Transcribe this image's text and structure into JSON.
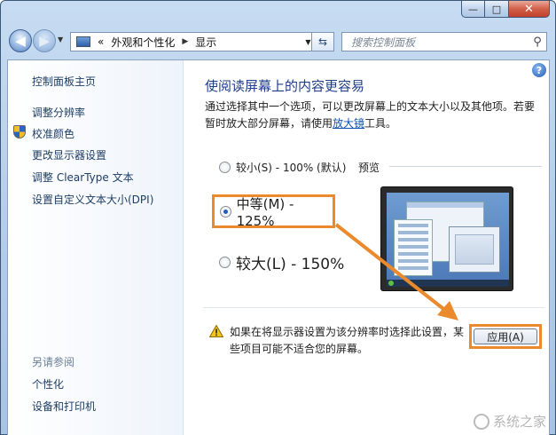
{
  "window": {
    "caption_buttons": {
      "minimize": "—",
      "maximize": "□",
      "close": "✕"
    }
  },
  "navbar": {
    "back_icon": "back-arrow-icon",
    "forward_icon": "forward-arrow-icon",
    "breadcrumb": {
      "prefix": "«",
      "segments": [
        "外观和个性化",
        "显示"
      ]
    },
    "search_placeholder": "搜索控制面板"
  },
  "sidebar": {
    "links": [
      "控制面板主页",
      "调整分辨率",
      "校准颜色",
      "更改显示器设置",
      "调整 ClearType 文本",
      "设置自定义文本大小(DPI)"
    ],
    "see_also_title": "另请参阅",
    "see_also_links": [
      "个性化",
      "设备和打印机"
    ]
  },
  "main": {
    "help": "?",
    "heading": "使阅读屏幕上的内容更容易",
    "desc_part1": "通过选择其中一个选项，可以更改屏幕上的文本大小以及其他项。若要暂时放大部分屏幕，请使用",
    "desc_link": "放大镜",
    "desc_part2": "工具。",
    "options": {
      "small": "较小(S) - 100% (默认)",
      "medium": "中等(M) - 125%",
      "large": "较大(L) - 150%"
    },
    "selected": "medium",
    "preview_label": "预览",
    "warning_text": "如果在将显示器设置为该分辨率时选择此设置，某些项目可能不适合您的屏幕。",
    "apply_label": "应用(A)"
  },
  "watermark": "系统之家",
  "colors": {
    "highlight": "#ea8a2c",
    "link": "#0e53b0",
    "heading": "#1e3e88"
  }
}
